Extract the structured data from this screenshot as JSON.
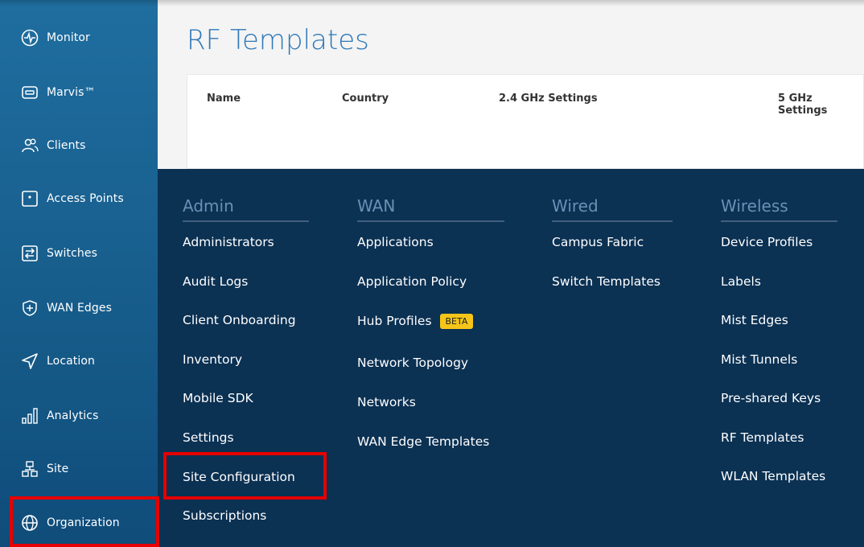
{
  "sidebar": {
    "items": [
      {
        "label": "Monitor",
        "icon": "heartbeat-circle-icon"
      },
      {
        "label": "Marvis™",
        "icon": "marvis-icon"
      },
      {
        "label": "Clients",
        "icon": "users-icon"
      },
      {
        "label": "Access Points",
        "icon": "access-point-icon"
      },
      {
        "label": "Switches",
        "icon": "switch-icon"
      },
      {
        "label": "WAN Edges",
        "icon": "wan-edge-shield-icon"
      },
      {
        "label": "Location",
        "icon": "location-arrow-icon"
      },
      {
        "label": "Analytics",
        "icon": "analytics-bars-icon"
      },
      {
        "label": "Site",
        "icon": "site-hierarchy-icon"
      },
      {
        "label": "Organization",
        "icon": "globe-icon"
      }
    ]
  },
  "page": {
    "title": "RF Templates",
    "table_headers": [
      "Name",
      "Country",
      "2.4 GHz Settings",
      "5 GHz Settings"
    ]
  },
  "menu": {
    "admin": {
      "title": "Admin",
      "items": [
        "Administrators",
        "Audit Logs",
        "Client Onboarding",
        "Inventory",
        "Mobile SDK",
        "Settings",
        "Site Configuration",
        "Subscriptions"
      ]
    },
    "wan": {
      "title": "WAN",
      "items": [
        "Applications",
        "Application Policy",
        "Hub Profiles",
        "Network Topology",
        "Networks",
        "WAN Edge Templates"
      ],
      "badge": "BETA"
    },
    "wired": {
      "title": "Wired",
      "items": [
        "Campus Fabric",
        "Switch Templates"
      ]
    },
    "wireless": {
      "title": "Wireless",
      "items": [
        "Device Profiles",
        "Labels",
        "Mist Edges",
        "Mist Tunnels",
        "Pre-shared Keys",
        "RF Templates",
        "WLAN Templates"
      ]
    }
  },
  "colors": {
    "sidebar": "#1f6ea0",
    "menu_bg": "#0b3153",
    "accent": "#2f78b8",
    "highlight": "#e60000",
    "badge": "#f5c518"
  }
}
